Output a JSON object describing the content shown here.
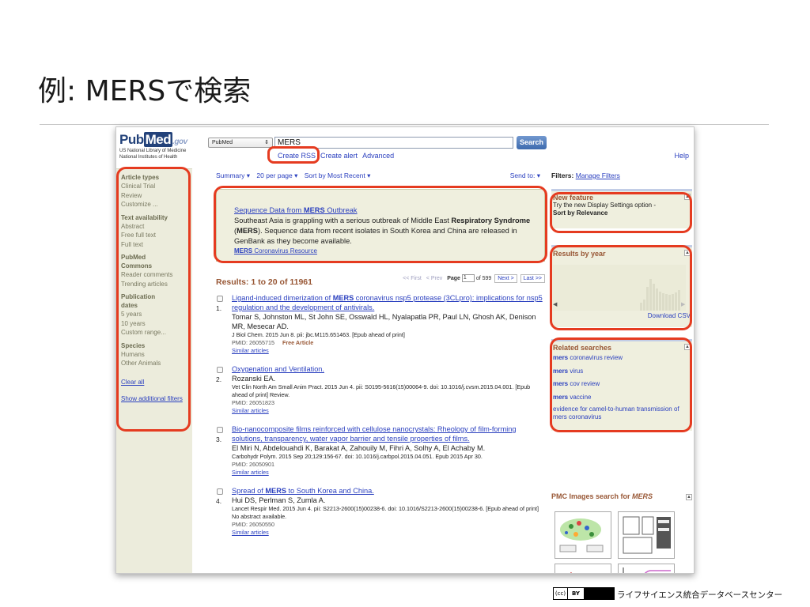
{
  "slide": {
    "title": "例: MERSで検索",
    "footer_org": "ライフサイエンス統合データベースセンター",
    "license_cc": "(cc)",
    "license_by": "BY"
  },
  "header": {
    "logo_pub": "Pub",
    "logo_med": "Med",
    "logo_gov": ".gov",
    "logo_line1": "US National Library of Medicine",
    "logo_line2": "National Institutes of Health",
    "database": "PubMed",
    "query": "MERS",
    "search_label": "Search",
    "rss_label": "Create RSS",
    "alert_label": "Create alert",
    "advanced_label": "Advanced",
    "help_label": "Help"
  },
  "left_sidebar": {
    "groups": [
      {
        "heading": "Article types",
        "items": [
          "Clinical Trial",
          "Review",
          "Customize ..."
        ]
      },
      {
        "heading": "Text availability",
        "items": [
          "Abstract",
          "Free full text",
          "Full text"
        ]
      },
      {
        "heading": "PubMed Commons",
        "items": [
          "Reader comments",
          "Trending articles"
        ]
      },
      {
        "heading": "Publication dates",
        "items": [
          "5 years",
          "10 years",
          "Custom range..."
        ]
      },
      {
        "heading": "Species",
        "items": [
          "Humans",
          "Other Animals"
        ]
      }
    ],
    "clear_all": "Clear all",
    "show_filters": "Show additional filters"
  },
  "display_bar": {
    "summary": "Summary ▾",
    "per_page": "20 per page ▾",
    "sort": "Sort by Most Recent ▾",
    "send_to": "Send to: ▾"
  },
  "alert_box": {
    "title_pre": "Sequence Data from ",
    "title_bold": "MERS",
    "title_post": " Outbreak",
    "text_1": "Southeast Asia is grappling with a serious outbreak of Middle East ",
    "text_bold_1": "Respiratory Syndrome",
    "text_2": " (",
    "text_bold_2": "MERS",
    "text_3": "). Sequence data from recent isolates in South Korea and China are released in GenBank as they become available.",
    "resource_bold": "MERS",
    "resource": " Coronavirus Resource"
  },
  "results": {
    "title": "Results: 1 to 20 of 11961",
    "first": "<< First",
    "prev": "< Prev",
    "page_label": "Page",
    "page_value": "1",
    "of_pages": "of 599",
    "next": "Next >",
    "last": "Last >>",
    "items": [
      {
        "num": "1.",
        "title_pre": "Ligand-induced dimerization of ",
        "title_bold": "MERS",
        "title_post": " coronavirus nsp5 protease (3CLpro): implications for nsp5 regulation and the development of antivirals.",
        "authors": "Tomar S, Johnston ML, St John SE, Osswald HL, Nyalapatla PR, Paul LN, Ghosh AK, Denison MR, Mesecar AD.",
        "source": "J Biol Chem. 2015 Jun 8. pii: jbc.M115.651463. [Epub ahead of print]",
        "pmid": "PMID: 26055715",
        "free": "Free Article",
        "similar": "Similar articles"
      },
      {
        "num": "2.",
        "title_pre": "Oxygenation and Ventilation.",
        "title_bold": "",
        "title_post": "",
        "authors": "Rozanski EA.",
        "source": "Vet Clin North Am Small Anim Pract. 2015 Jun 4. pii: S0195-5616(15)00064-9. doi: 10.1016/j.cvsm.2015.04.001. [Epub ahead of print] Review.",
        "pmid": "PMID: 26051823",
        "free": "",
        "similar": "Similar articles"
      },
      {
        "num": "3.",
        "title_pre": "Bio-nanocomposite films reinforced with cellulose nanocrystals: Rheology of film-forming solutions, transparency, water vapor barrier and tensile properties of films.",
        "title_bold": "",
        "title_post": "",
        "authors": "El Miri N, Abdelouahdi K, Barakat A, Zahouily M, Fihri A, Solhy A, El Achaby M.",
        "source": "Carbohydr Polym. 2015 Sep 20;129:156-67. doi: 10.1016/j.carbpol.2015.04.051. Epub 2015 Apr 30.",
        "pmid": "PMID: 26050901",
        "free": "",
        "similar": "Similar articles"
      },
      {
        "num": "4.",
        "title_pre": "Spread of ",
        "title_bold": "MERS",
        "title_post": " to South Korea and China.",
        "authors": "Hui DS, Perlman S, Zumla A.",
        "source": "Lancet Respir Med. 2015 Jun 4. pii: S2213-2600(15)00238-6. doi: 10.1016/S2213-2600(15)00238-6. [Epub ahead of print] No abstract available.",
        "pmid": "PMID: 26050550",
        "free": "",
        "similar": "Similar articles"
      }
    ]
  },
  "right_sidebar": {
    "filters_label": "Filters:",
    "manage_filters": "Manage Filters",
    "new_feature_head": "New feature",
    "new_feature_text": "Try the new Display Settings option -",
    "new_feature_bold": "Sort by Relevance",
    "results_by_year_head": "Results by year",
    "download_csv": "Download CSV",
    "related_head": "Related searches",
    "related": [
      {
        "bold": "mers",
        "rest": " coronavirus review"
      },
      {
        "bold": "mers",
        "rest": " virus"
      },
      {
        "bold": "mers",
        "rest": " cov review"
      },
      {
        "bold": "mers",
        "rest": " vaccine"
      },
      {
        "bold": "",
        "rest": "evidence for camel-to-human transmission of mers coronavirus"
      }
    ],
    "pmc_head": "PMC Images search for ",
    "pmc_head_italic": "MERS"
  },
  "colors": {
    "highlight_red": "#e53b20",
    "link_blue": "#2a3fbf",
    "heading_brown": "#985735",
    "sidebar_beige": "#ececdc"
  }
}
